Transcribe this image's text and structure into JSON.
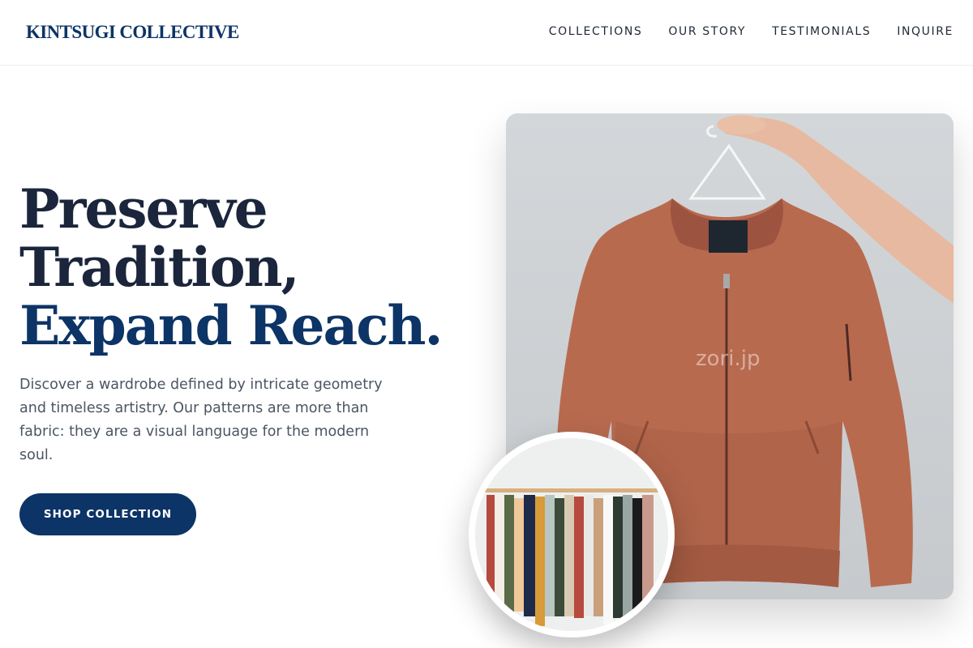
{
  "brand": {
    "name": "KINTSUGI COLLECTIVE"
  },
  "nav": {
    "items": [
      "COLLECTIONS",
      "OUR STORY",
      "TESTIMONIALS",
      "INQUIRE"
    ]
  },
  "hero": {
    "headline_line1": "Preserve",
    "headline_line2": "Tradition,",
    "headline_line3": "Expand Reach.",
    "lede": "Discover a wardrobe defined by intricate geometry and timeless artistry. Our patterns are more than fabric: they are a visual language for the modern soul.",
    "cta_label": "SHOP COLLECTION"
  },
  "image": {
    "watermark": "zori.jp",
    "subject": "copper bomber jacket on hanger",
    "inset_subject": "clothing rack with assorted garments"
  },
  "colors": {
    "brand_navy": "#0d3466",
    "headline_dark": "#1b253b",
    "jacket": "#b86a4f"
  }
}
